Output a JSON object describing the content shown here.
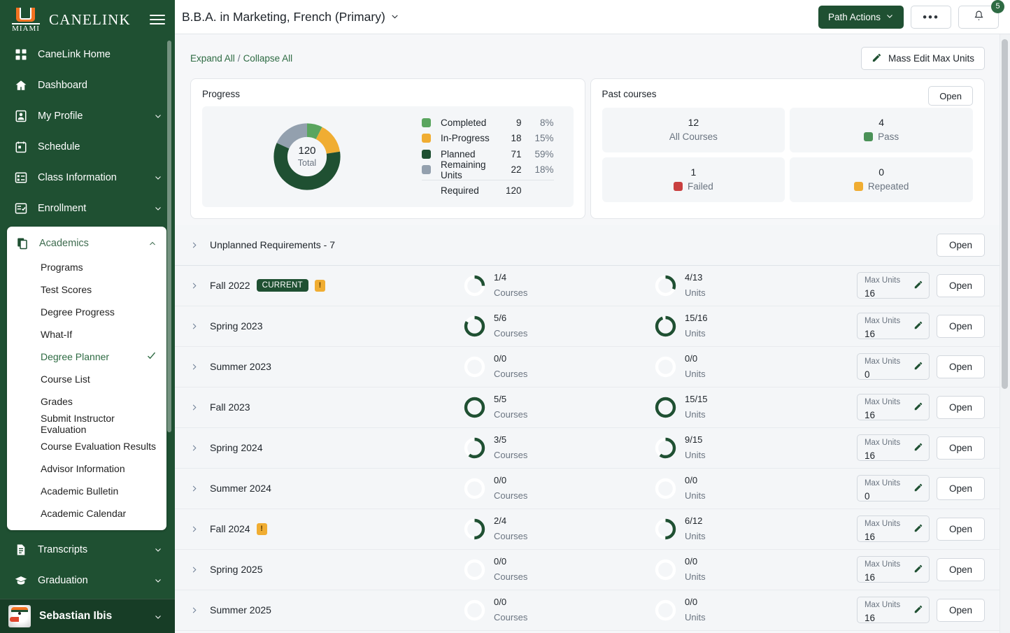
{
  "sidebar": {
    "brand": "CANELINK",
    "logo_text": "MIAMI",
    "items": [
      {
        "label": "CaneLink Home",
        "icon": "grid-icon",
        "expandable": false
      },
      {
        "label": "Dashboard",
        "icon": "home-icon",
        "expandable": false
      },
      {
        "label": "My Profile",
        "icon": "person-icon",
        "expandable": true
      },
      {
        "label": "Schedule",
        "icon": "calendar-icon",
        "expandable": false
      },
      {
        "label": "Class Information",
        "icon": "list-icon",
        "expandable": true
      },
      {
        "label": "Enrollment",
        "icon": "checklist-icon",
        "expandable": true
      }
    ],
    "academics": {
      "label": "Academics",
      "icon": "documents-icon",
      "sub_items": [
        {
          "label": "Programs",
          "active": false
        },
        {
          "label": "Test Scores",
          "active": false
        },
        {
          "label": "Degree Progress",
          "active": false
        },
        {
          "label": "What-If",
          "active": false
        },
        {
          "label": "Degree Planner",
          "active": true
        },
        {
          "label": "Course List",
          "active": false
        },
        {
          "label": "Grades",
          "active": false
        },
        {
          "label": "Submit Instructor Evaluation",
          "active": false
        },
        {
          "label": "Course Evaluation Results",
          "active": false
        },
        {
          "label": "Advisor Information",
          "active": false
        },
        {
          "label": "Academic Bulletin",
          "active": false
        },
        {
          "label": "Academic Calendar",
          "active": false
        }
      ]
    },
    "items_after": [
      {
        "label": "Transcripts",
        "icon": "file-icon",
        "expandable": true
      },
      {
        "label": "Graduation",
        "icon": "cap-icon",
        "expandable": true
      }
    ],
    "user": {
      "name": "Sebastian Ibis",
      "avatar": "ibis-mascot-avatar"
    }
  },
  "topbar": {
    "title": "B.B.A. in Marketing, French (Primary)",
    "path_actions_label": "Path Actions",
    "more_label": "•••",
    "notification_count": "5"
  },
  "toolbar": {
    "expand_all": "Expand All",
    "separator": "/",
    "collapse_all": "Collapse All",
    "mass_edit_label": "Mass Edit Max Units"
  },
  "progress_card": {
    "title": "Progress",
    "total": "120",
    "total_label": "Total",
    "required_label": "Required",
    "required_value": "120"
  },
  "past_courses": {
    "title": "Past courses",
    "open_label": "Open",
    "tiles": [
      {
        "value": "12",
        "label": "All Courses",
        "color": null
      },
      {
        "value": "4",
        "label": "Pass",
        "color": "#4a9157"
      },
      {
        "value": "1",
        "label": "Failed",
        "color": "#c94040"
      },
      {
        "value": "0",
        "label": "Repeated",
        "color": "#f0ad32"
      }
    ]
  },
  "unplanned": {
    "label": "Unplanned Requirements - 7",
    "open_label": "Open"
  },
  "terms": [
    {
      "name": "Fall 2022",
      "badge": "CURRENT",
      "warning": true,
      "courses": "1/4",
      "courses_pct": 25,
      "units": "4/13",
      "units_pct": 31,
      "courses_label": "Courses",
      "units_label": "Units",
      "max_units_label": "Max Units",
      "max_units": "16",
      "open_label": "Open"
    },
    {
      "name": "Spring 2023",
      "badge": null,
      "warning": false,
      "courses": "5/6",
      "courses_pct": 83,
      "units": "15/16",
      "units_pct": 94,
      "courses_label": "Courses",
      "units_label": "Units",
      "max_units_label": "Max Units",
      "max_units": "16",
      "open_label": "Open"
    },
    {
      "name": "Summer 2023",
      "badge": null,
      "warning": false,
      "courses": "0/0",
      "courses_pct": 0,
      "units": "0/0",
      "units_pct": 0,
      "courses_label": "Courses",
      "units_label": "Units",
      "max_units_label": "Max Units",
      "max_units": "0",
      "open_label": "Open"
    },
    {
      "name": "Fall 2023",
      "badge": null,
      "warning": false,
      "courses": "5/5",
      "courses_pct": 100,
      "units": "15/15",
      "units_pct": 100,
      "courses_label": "Courses",
      "units_label": "Units",
      "max_units_label": "Max Units",
      "max_units": "16",
      "open_label": "Open"
    },
    {
      "name": "Spring 2024",
      "badge": null,
      "warning": false,
      "courses": "3/5",
      "courses_pct": 60,
      "units": "9/15",
      "units_pct": 60,
      "courses_label": "Courses",
      "units_label": "Units",
      "max_units_label": "Max Units",
      "max_units": "16",
      "open_label": "Open"
    },
    {
      "name": "Summer 2024",
      "badge": null,
      "warning": false,
      "courses": "0/0",
      "courses_pct": 0,
      "units": "0/0",
      "units_pct": 0,
      "courses_label": "Courses",
      "units_label": "Units",
      "max_units_label": "Max Units",
      "max_units": "0",
      "open_label": "Open"
    },
    {
      "name": "Fall 2024",
      "badge": null,
      "warning": true,
      "courses": "2/4",
      "courses_pct": 50,
      "units": "6/12",
      "units_pct": 50,
      "courses_label": "Courses",
      "units_label": "Units",
      "max_units_label": "Max Units",
      "max_units": "16",
      "open_label": "Open"
    },
    {
      "name": "Spring 2025",
      "badge": null,
      "warning": false,
      "courses": "0/0",
      "courses_pct": 0,
      "units": "0/0",
      "units_pct": 0,
      "courses_label": "Courses",
      "units_label": "Units",
      "max_units_label": "Max Units",
      "max_units": "16",
      "open_label": "Open"
    },
    {
      "name": "Summer 2025",
      "badge": null,
      "warning": false,
      "courses": "0/0",
      "courses_pct": 0,
      "units": "0/0",
      "units_pct": 0,
      "courses_label": "Courses",
      "units_label": "Units",
      "max_units_label": "Max Units",
      "max_units": "16",
      "open_label": "Open"
    }
  ],
  "colors": {
    "brand_green": "#1f5032",
    "completed": "#5aa55f",
    "in_progress": "#f0ad32",
    "planned": "#1f5032",
    "remaining": "#93a0ae",
    "failed": "#c94040"
  },
  "chart_data": {
    "type": "pie",
    "title": "Progress",
    "center_value": "120",
    "center_label": "Total",
    "categories": [
      "Completed",
      "In-Progress",
      "Planned",
      "Remaining Units"
    ],
    "values": [
      9,
      18,
      71,
      22
    ],
    "percents": [
      "8%",
      "15%",
      "59%",
      "18%"
    ],
    "colors": [
      "#5aa55f",
      "#f0ad32",
      "#1f5032",
      "#93a0ae"
    ],
    "total_required": 120,
    "legend_position": "right"
  }
}
